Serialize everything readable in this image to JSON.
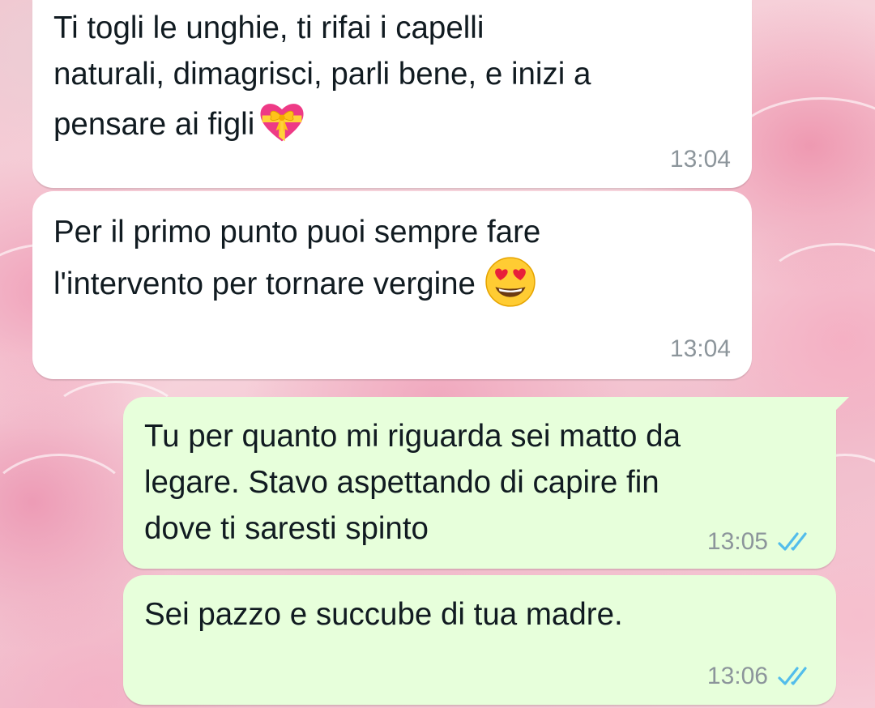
{
  "messages": [
    {
      "direction": "incoming",
      "lines": [
        "Ti togli le unghie, ti rifai i capelli",
        "naturali, dimagrisci, parli bene, e inizi a",
        "pensare ai figli"
      ],
      "emoji": "heart-with-ribbon",
      "time": "13:04"
    },
    {
      "direction": "incoming",
      "lines": [
        "Per il primo punto puoi sempre fare",
        "l'intervento per tornare vergine"
      ],
      "emoji": "smiling-face-with-heart-eyes",
      "time": "13:04"
    },
    {
      "direction": "outgoing",
      "lines": [
        "Tu per quanto mi riguarda sei matto da",
        "legare. Stavo aspettando di capire fin",
        "dove ti saresti spinto"
      ],
      "time": "13:05",
      "status": "read"
    },
    {
      "direction": "outgoing",
      "lines": [
        "Sei pazzo e succube di tua madre."
      ],
      "time": "13:06",
      "status": "read"
    }
  ],
  "colors": {
    "incoming_bubble": "#ffffff",
    "outgoing_bubble": "#e7ffdb",
    "read_ticks": "#53bdeb",
    "timestamp": "#8c959b"
  }
}
